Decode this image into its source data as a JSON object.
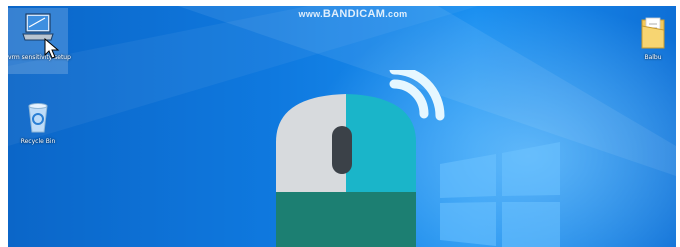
{
  "watermark": {
    "prefix": "www.",
    "brand": "BANDICAM",
    "suffix": ".com"
  },
  "desktop_icons": [
    {
      "label": "vrm sensitivity setup",
      "icon": "settings-app-icon"
    },
    {
      "label": "Recycle Bin",
      "icon": "recycle-bin-icon"
    },
    {
      "label": "Balbu",
      "icon": "folder-icon"
    }
  ],
  "colors": {
    "desktop_blue": "#0f79df",
    "mouse_gray": "#d7dadd",
    "mouse_cyan": "#1ab5c9",
    "mouse_teal": "#1c7f72",
    "wheel_dark": "#3b4148",
    "waves": "#e6f7ff"
  },
  "logo_art": "wireless-mouse-logo"
}
